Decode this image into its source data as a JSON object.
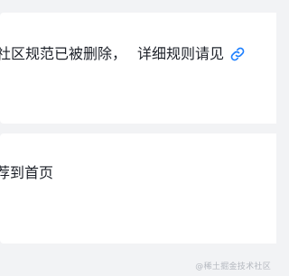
{
  "notice_card": {
    "text_part1": "社区规范已被删除，",
    "text_part2": "详细规则请见",
    "link_icon": "link-icon",
    "link_color": "#1e80ff"
  },
  "recommend_card": {
    "text": "荐到首页"
  },
  "watermark": {
    "text": "@稀土掘金技术社区"
  },
  "colors": {
    "background": "#f2f3f5",
    "card": "#ffffff",
    "text": "#1d2129",
    "watermark": "#b4b8bf"
  }
}
